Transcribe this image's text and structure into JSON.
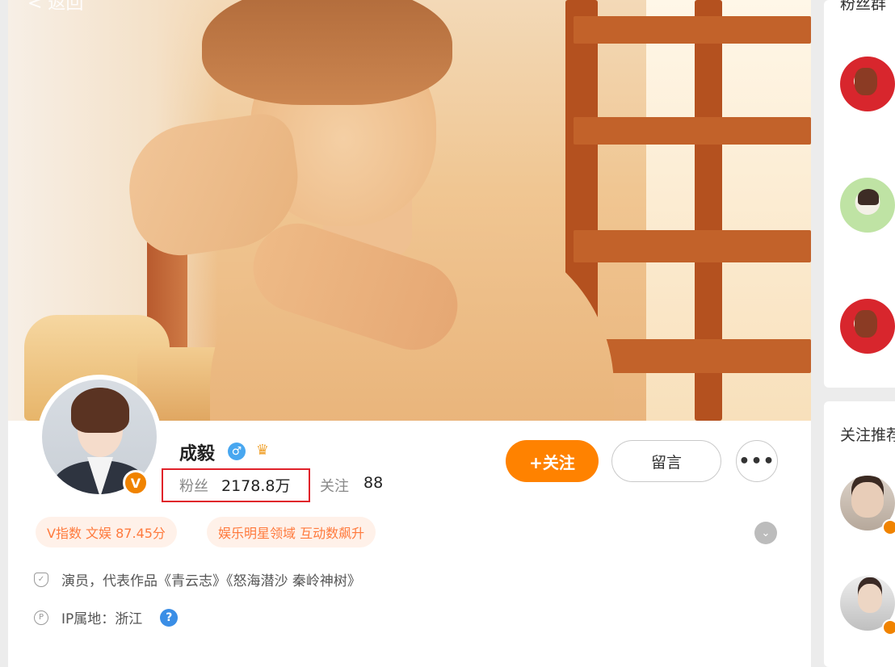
{
  "header": {
    "back_label": "< 返回"
  },
  "profile": {
    "name": "成毅",
    "badge_letter": "V",
    "gender_symbol": "♂",
    "fans_label": "粉丝",
    "fans_value": "2178.8万",
    "following_label": "关注",
    "following_value": "88",
    "follow_button": "+关注",
    "message_button": "留言",
    "more_button": "•••",
    "tags": [
      "V指数 文娱 87.45分",
      "娱乐明星领域 互动数飙升"
    ],
    "bio": "演员，代表作品《青云志》《怒海潜沙 秦岭神树》",
    "ip_location": "IP属地：浙江",
    "help_symbol": "?"
  },
  "sidebar": {
    "fans_group_title": "粉丝群",
    "recommend_title": "关注推荐"
  },
  "colors": {
    "accent": "#ff8200",
    "highlight_box": "#e0212a",
    "tag_bg": "#fff1e9",
    "tag_text": "#ff7a3d",
    "help_blue": "#3a8ee6"
  },
  "icons": [
    "back-icon",
    "gender-male-icon",
    "crown-icon",
    "verified-v-icon",
    "expand-chevron-icon",
    "shield-icon",
    "ip-location-icon",
    "help-icon"
  ]
}
